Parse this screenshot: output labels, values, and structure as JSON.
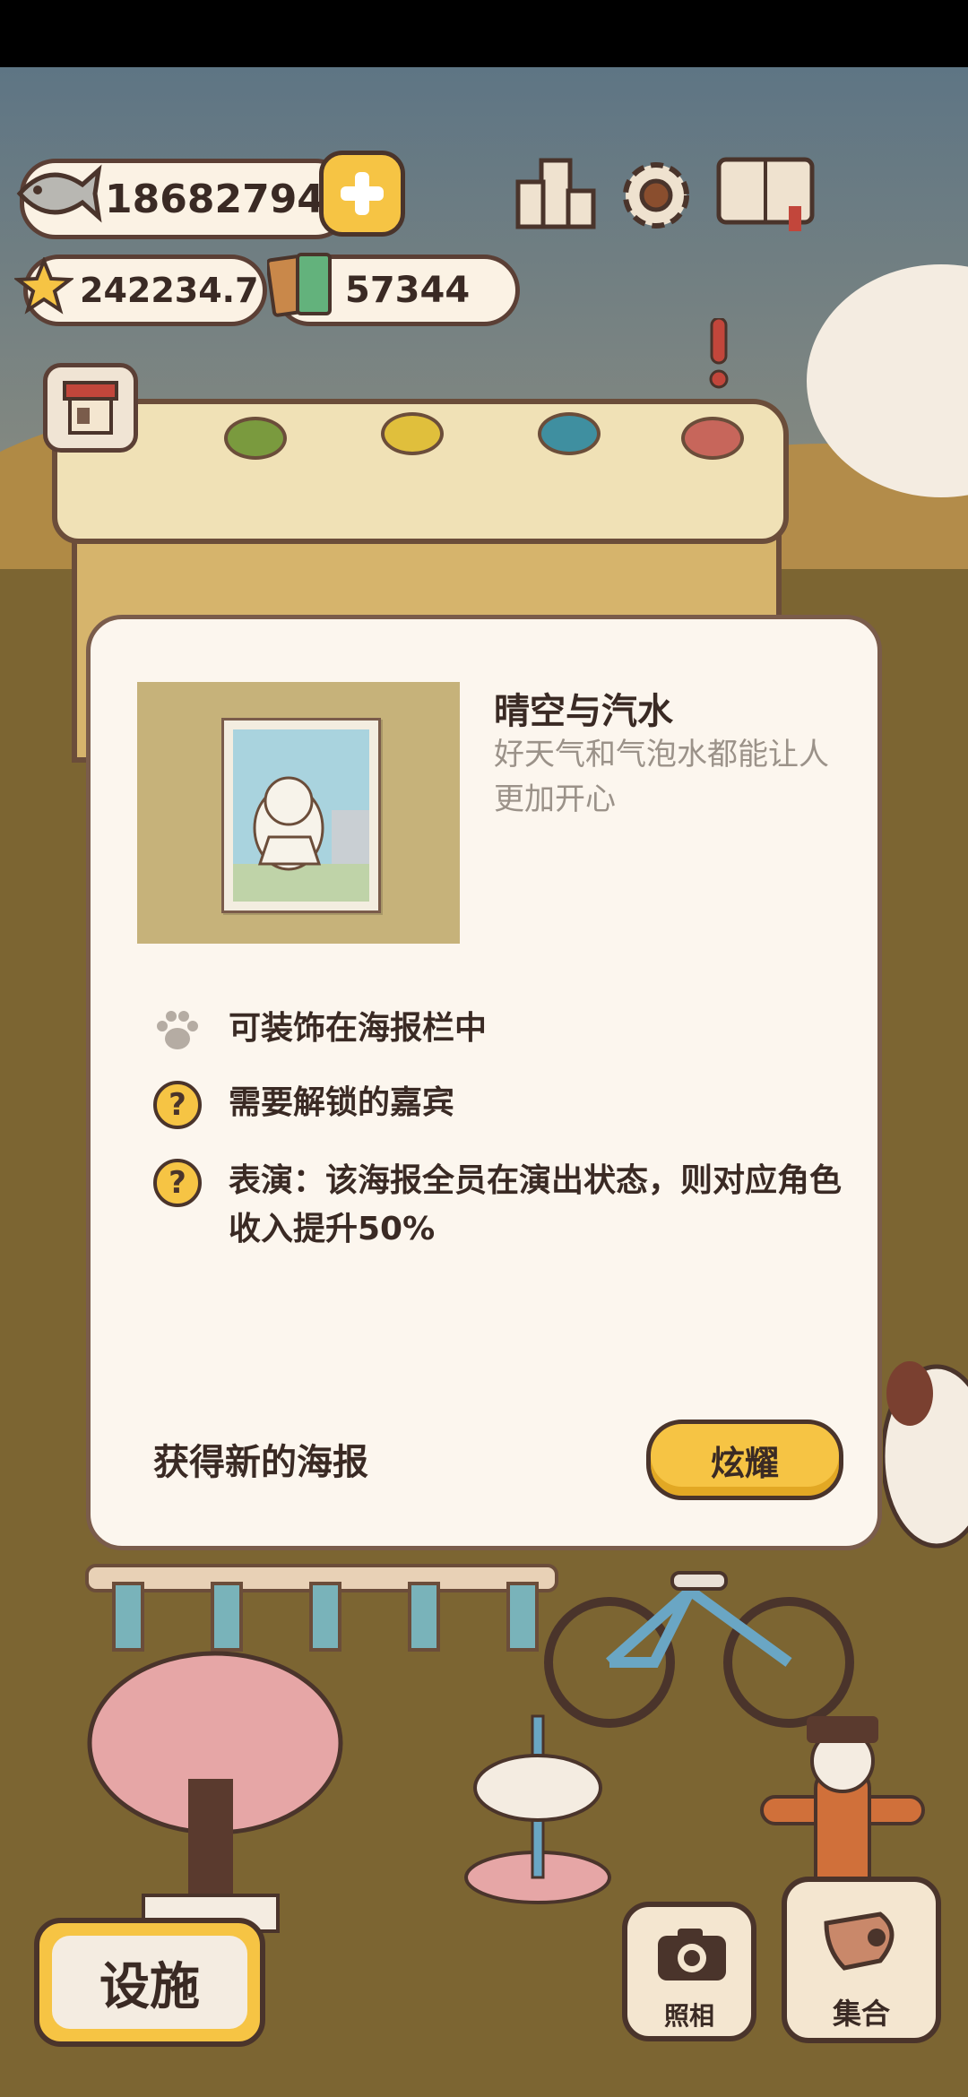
{
  "hud": {
    "fish_count": "18682794",
    "star_count": "242234.7",
    "ticket_count": "57344",
    "icons": [
      "fish-icon",
      "plus-icon",
      "star-icon",
      "ticket-icon",
      "ranking-icon",
      "gear-icon",
      "guidebook-icon"
    ]
  },
  "modal": {
    "poster_name": "晴空与汽水",
    "poster_desc": "好天气和气泡水都能让人更加开心",
    "features": [
      {
        "icon": "paw-icon",
        "text": "可装饰在海报栏中"
      },
      {
        "icon": "question-icon",
        "text": "需要解锁的嘉宾"
      },
      {
        "icon": "question-icon",
        "text": "表演：该海报全员在演出状态，则对应角色收入提升50%"
      }
    ],
    "footer_label": "获得新的海报",
    "show_button": "炫耀"
  },
  "bottom": {
    "facility_button": "设施",
    "photo_button": "照相",
    "gather_button": "集合"
  },
  "colors": {
    "accent_yellow": "#f6c444",
    "outline_brown": "#4a342b",
    "panel_bg": "#fcf6ee"
  }
}
